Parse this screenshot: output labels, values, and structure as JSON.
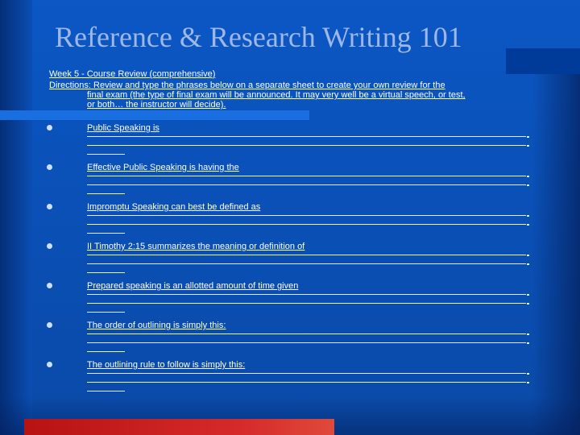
{
  "slide": {
    "title": "Reference & Research Writing 101",
    "week": "Week 5 - Course Review (comprehensive)",
    "directions_line1": "Directions: Review  and type the phrases below on a separate sheet to create your own review for the",
    "directions_line2": "final exam (the type of final exam will be announced. It may very well be a virtual speech, or test,",
    "directions_line3": "or both… the instructor will decide).",
    "items": [
      {
        "prompt": "Public Speaking is"
      },
      {
        "prompt": "Effective Public Speaking is having the"
      },
      {
        "prompt": "Impromptu Speaking can best be defined as"
      },
      {
        "prompt": "II Timothy 2:15 summarizes the meaning or definition of"
      },
      {
        "prompt": "Prepared speaking is an allotted amount of time given"
      },
      {
        "prompt": "The order of outlining is simply this:"
      },
      {
        "prompt": "The outlining rule to follow is simply this:"
      }
    ]
  },
  "colors": {
    "background": "#0b57c4",
    "title": "#9db8e6",
    "highlight": "#1a6fe0",
    "accent_red": "#c81d1d",
    "text": "#ffffff"
  }
}
